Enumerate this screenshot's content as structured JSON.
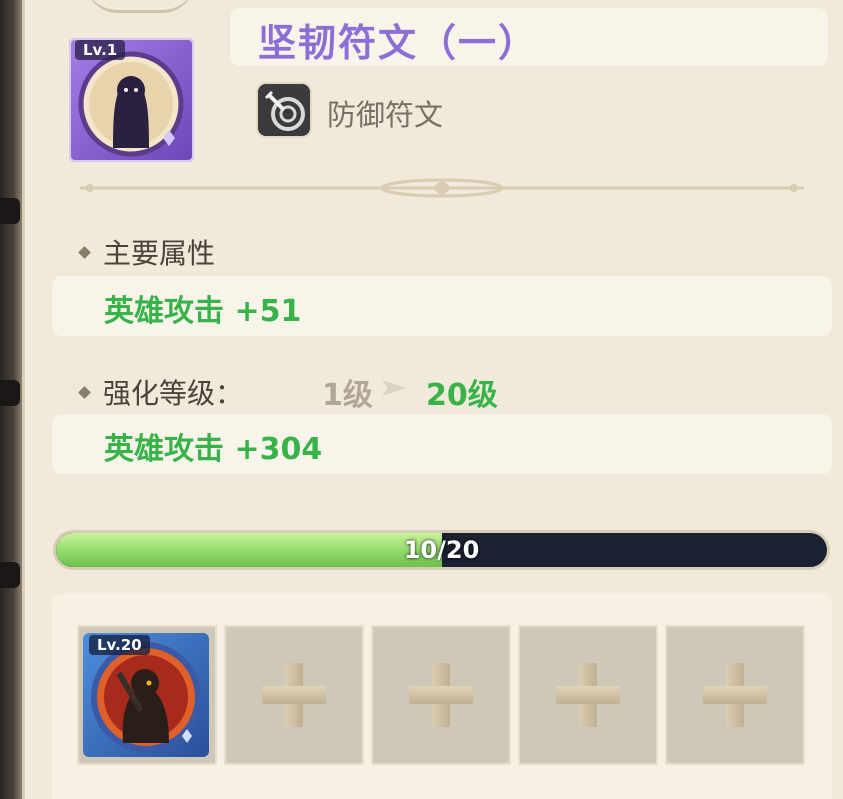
{
  "rune": {
    "level_badge": "Lv.1",
    "title": "坚韧符文（一）",
    "type_label": "防御符文",
    "type_icon": "shield-sword-icon"
  },
  "main_attribute": {
    "heading": "主要属性",
    "value": "英雄攻击 +51"
  },
  "enhance": {
    "heading": "强化等级：",
    "from_level": "1级",
    "to_level": "20级",
    "value": "英雄攻击 +304"
  },
  "progress": {
    "text": "10/20",
    "current": 10,
    "max": 20
  },
  "slots": [
    {
      "filled": true,
      "level_badge": "Lv.20"
    },
    {
      "filled": false
    },
    {
      "filled": false
    },
    {
      "filled": false
    },
    {
      "filled": false
    }
  ],
  "colors": {
    "title": "#8b6fd6",
    "stat_green": "#37b34a",
    "progress_fill": "#8fd96a",
    "progress_track": "#1b2130"
  }
}
